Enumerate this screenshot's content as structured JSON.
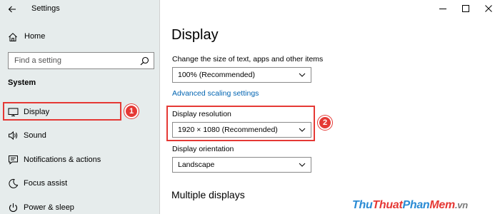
{
  "window": {
    "title": "Settings"
  },
  "sidebar": {
    "home_label": "Home",
    "search_placeholder": "Find a setting",
    "section": "System",
    "items": [
      {
        "label": "Display",
        "icon": "monitor-icon",
        "selected": true
      },
      {
        "label": "Sound",
        "icon": "speaker-icon"
      },
      {
        "label": "Notifications & actions",
        "icon": "notification-icon"
      },
      {
        "label": "Focus assist",
        "icon": "moon-icon"
      },
      {
        "label": "Power & sleep",
        "icon": "power-icon"
      }
    ]
  },
  "main": {
    "title": "Display",
    "scale_label": "Change the size of text, apps and other items",
    "scale_value": "100% (Recommended)",
    "advanced_link": "Advanced scaling settings",
    "resolution_label": "Display resolution",
    "resolution_value": "1920 × 1080 (Recommended)",
    "orientation_label": "Display orientation",
    "orientation_value": "Landscape",
    "multiple_displays": "Multiple displays"
  },
  "annotations": [
    {
      "number": "1",
      "target": "Display"
    },
    {
      "number": "2",
      "target": "Display resolution"
    }
  ],
  "annotation_color": "#e53935",
  "accent_color": "#0063b1",
  "watermark": {
    "part1": "Thu",
    "part2": "Thuat",
    "part3": "Phan",
    "part4": "Mem",
    "part5": ".vn"
  }
}
